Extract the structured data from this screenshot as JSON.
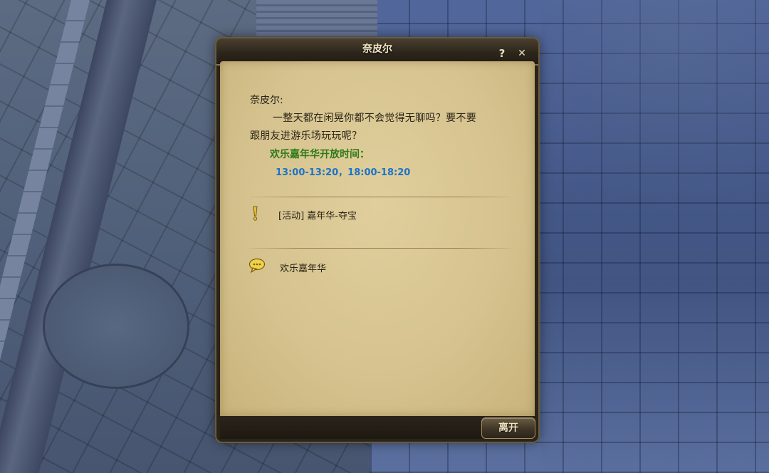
{
  "dialog": {
    "title": "奈皮尔",
    "help_icon": "question-icon",
    "close_icon": "close-icon",
    "npc_name": "奈皮尔:",
    "message_line1": "一整天都在闲晃你都不会觉得无聊吗？要不要",
    "message_line2": "跟朋友进游乐场玩玩呢？",
    "event_title": "欢乐嘉年华开放时间：",
    "event_times": "13:00-13:20，18:00-18:20",
    "options": [
      {
        "icon": "exclamation-quest-icon",
        "label": "[活动] 嘉年华-夺宝"
      },
      {
        "icon": "speech-bubble-icon",
        "label": "欢乐嘉年华"
      }
    ],
    "leave_label": "离开"
  },
  "colors": {
    "panel": "#d6c38f",
    "event_green": "#2e7a19",
    "time_blue": "#1a73c9",
    "frame": "#2a2418"
  }
}
